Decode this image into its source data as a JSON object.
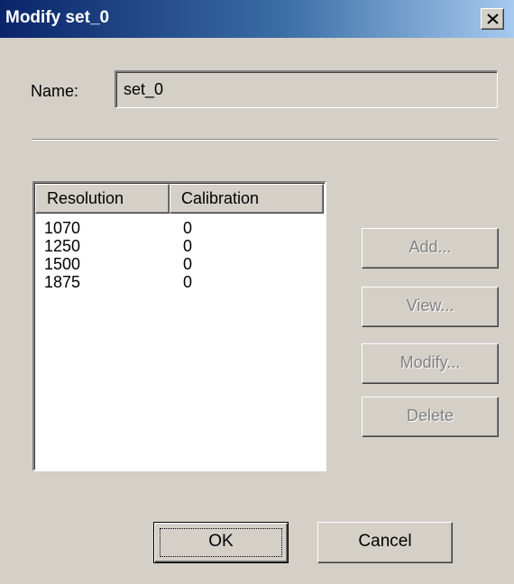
{
  "window": {
    "title": "Modify set_0",
    "close_icon": "close-icon"
  },
  "form": {
    "name_label": "Name:",
    "name_value": "set_0"
  },
  "table": {
    "columns": [
      "Resolution",
      "Calibration"
    ],
    "rows": [
      [
        "1070",
        "0"
      ],
      [
        "1250",
        "0"
      ],
      [
        "1500",
        "0"
      ],
      [
        "1875",
        "0"
      ]
    ]
  },
  "side_buttons": {
    "add": "Add...",
    "view": "View...",
    "modify": "Modify...",
    "delete": "Delete"
  },
  "dialog_buttons": {
    "ok": "OK",
    "cancel": "Cancel"
  }
}
